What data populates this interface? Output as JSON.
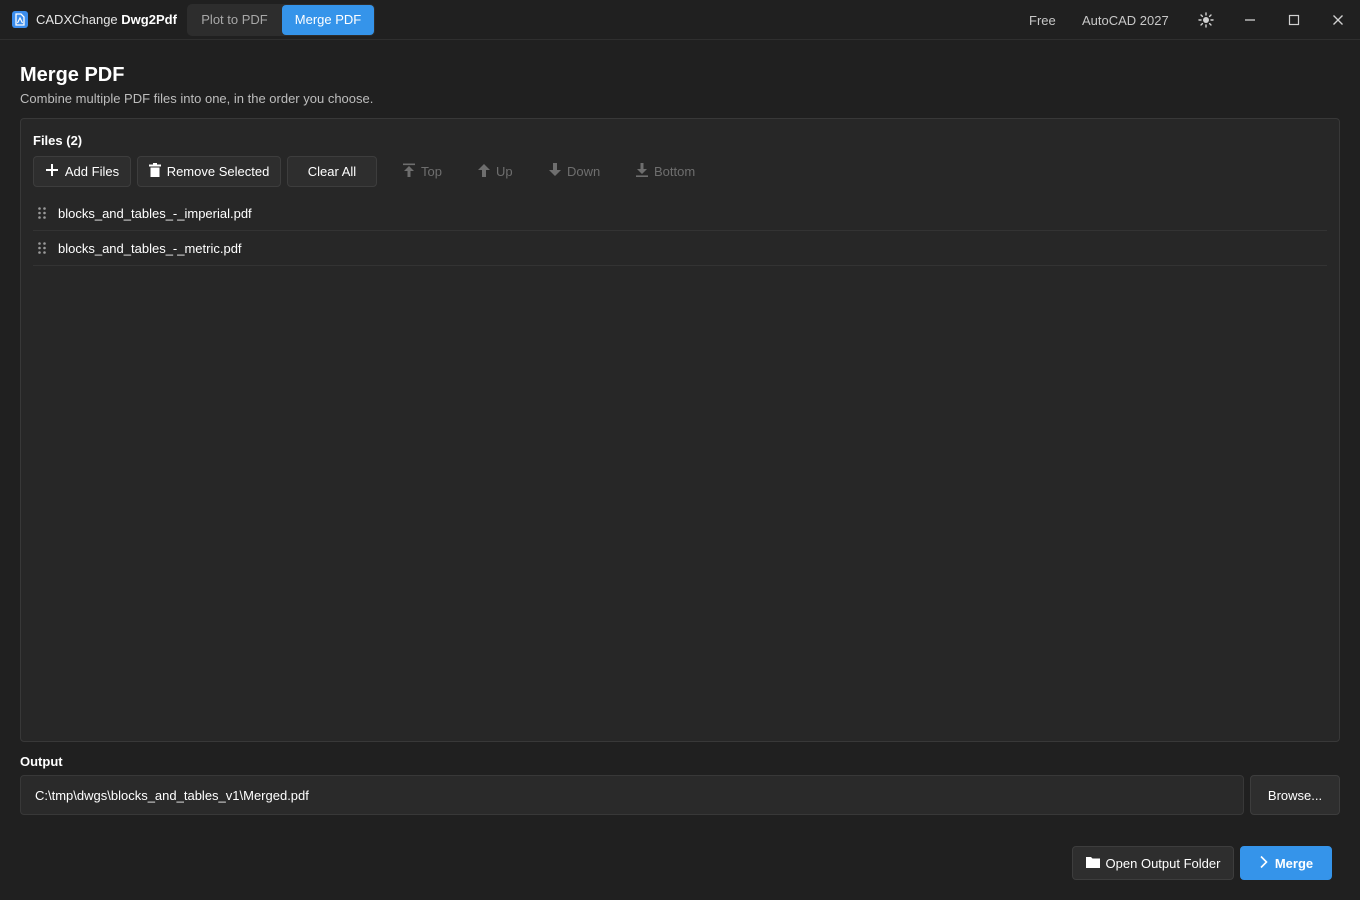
{
  "app": {
    "name_prefix": "CADXChange",
    "name_suffix": "Dwg2Pdf"
  },
  "tabs": [
    {
      "label": "Plot to PDF",
      "active": false
    },
    {
      "label": "Merge PDF",
      "active": true
    }
  ],
  "titlebar": {
    "license": "Free",
    "cad_version": "AutoCAD 2027",
    "icons": [
      "theme-toggle-icon",
      "minimize-icon",
      "maximize-icon",
      "close-icon"
    ]
  },
  "page": {
    "title": "Merge PDF",
    "subtitle": "Combine multiple PDF files into one, in the order you choose."
  },
  "files": {
    "heading": "Files (2)",
    "toolbar": {
      "add_label": "Add Files",
      "remove_label": "Remove Selected",
      "clear_label": "Clear All",
      "top_label": "Top",
      "up_label": "Up",
      "down_label": "Down",
      "bottom_label": "Bottom"
    },
    "items": [
      {
        "name": "blocks_and_tables_-_imperial.pdf"
      },
      {
        "name": "blocks_and_tables_-_metric.pdf"
      }
    ]
  },
  "output": {
    "label": "Output",
    "path": "C:\\tmp\\dwgs\\blocks_and_tables_v1\\Merged.pdf",
    "browse_label": "Browse..."
  },
  "actions": {
    "open_folder_label": "Open Output Folder",
    "merge_label": "Merge"
  },
  "colors": {
    "accent": "#3594ea",
    "background": "#202020",
    "panel": "#272727",
    "disabled_text": "#6e6e6e"
  }
}
